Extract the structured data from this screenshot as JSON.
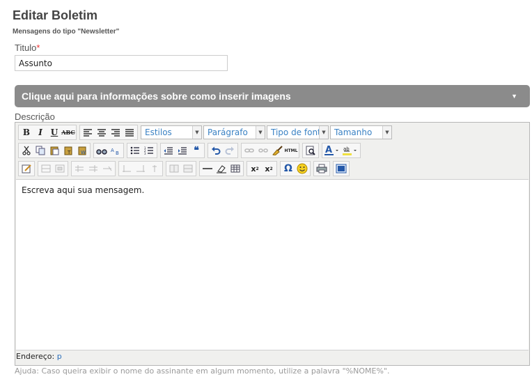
{
  "page": {
    "title": "Editar Boletim",
    "subtitle": "Mensagens do tipo \"Newsletter\""
  },
  "title_field": {
    "label": "Titulo",
    "required_mark": "*",
    "value": "Assunto"
  },
  "accordion": {
    "label": "Clique aqui para informações sobre como inserir imagens",
    "collapsed": true
  },
  "description": {
    "label": "Descrição",
    "toolbar": {
      "styles": "Estilos",
      "format": "Parágrafo",
      "font": "Tipo de fonte",
      "size": "Tamanho",
      "bold": "B",
      "italic": "I",
      "underline": "U",
      "strike": "ABC",
      "html": "HTML",
      "quote": "66",
      "subscript": "x",
      "superscript": "x",
      "omega": "Ω",
      "font_color": "A"
    },
    "content": "Escreva aqui sua mensagem.",
    "status_label": "Endereço:",
    "status_path": "p"
  },
  "help": "Ajuda: Caso queira exibir o nome do assinante em algum momento, utilize a palavra \"%NOME%\".",
  "colors": {
    "accordion_bg": "#8b8b8b",
    "required": "#e33333",
    "link": "#2a6ebb"
  }
}
